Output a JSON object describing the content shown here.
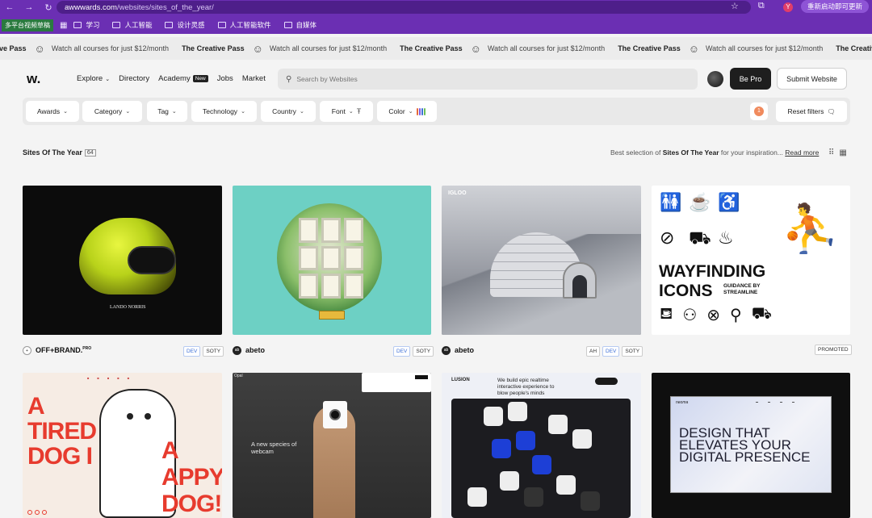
{
  "browser": {
    "url_domain": "awwwards.com",
    "url_path": "/websites/sites_of_the_year/",
    "profile_initial": "Y",
    "restart_label": "重新启动即可更新",
    "bookmarks": [
      "多平台视频草稿",
      "学习",
      "人工智能",
      "设计灵感",
      "人工智能软件",
      "自媒体"
    ]
  },
  "ticker": {
    "items": [
      {
        "brand": "reative Pass",
        "text": "Watch all courses for just $12/month"
      },
      {
        "brand": "The Creative Pass",
        "text": "Watch all courses for just $12/month"
      },
      {
        "brand": "The Creative Pass",
        "text": "Watch all courses for just $12/month"
      },
      {
        "brand": "The Creative Pass",
        "text": "Watch all courses for just $12/month"
      },
      {
        "brand": "The Creative Pass",
        "text": ""
      }
    ]
  },
  "header": {
    "logo": "w.",
    "nav": [
      "Explore",
      "Directory",
      "Academy",
      "Jobs",
      "Market"
    ],
    "academy_badge": "New",
    "search_placeholder": "Search by Websites",
    "be_pro": "Be Pro",
    "submit": "Submit Website"
  },
  "filters": {
    "awards": "Awards",
    "category": "Category",
    "tag": "Tag",
    "technology": "Technology",
    "country": "Country",
    "font": "Font",
    "color": "Color",
    "active_count": "1",
    "reset": "Reset filters",
    "color_swatches": [
      "#e66b3c",
      "#7b5ce6",
      "#3d6fd6",
      "#6bbf59"
    ]
  },
  "section": {
    "title": "Sites Of The Year",
    "count": "64",
    "desc_prefix": "Best selection of",
    "desc_bold": "Sites Of The Year",
    "desc_suffix": "for your inspiration...",
    "read_more": "Read more"
  },
  "cards": [
    {
      "name": "OFF+BRAND.",
      "badge": "PRO",
      "tags": [
        "DEV",
        "SOTY"
      ],
      "image_text": "LANDO NORRIS"
    },
    {
      "name": "abeto",
      "tags": [
        "DEV",
        "SOTY"
      ]
    },
    {
      "name": "abeto",
      "tags": [
        "AH",
        "DEV",
        "SOTY"
      ],
      "image_text": "IGLOO"
    },
    {
      "image_title": "WAYFINDING ICONS",
      "image_sub": "GUIDANCE BY STREAMLINE",
      "promoted": "PROMOTED"
    },
    {
      "image_text": "A TIRED DOG I",
      "image_text2": "A APPY DOG!"
    },
    {
      "image_text": "A new species of webcam",
      "logo": "Opal"
    },
    {
      "image_text": "We build epic realtime interactive experience to blow people's minds",
      "logo": "LUSION"
    },
    {
      "image_text": "DESIGN THAT ELEVATES YOUR DIGITAL PRESENCE",
      "logo": "neoma"
    }
  ],
  "colors": {
    "chrome": "#6b2fb3",
    "accent_orange": "#f08a5d",
    "dev_tag": "#3d6fd6"
  }
}
